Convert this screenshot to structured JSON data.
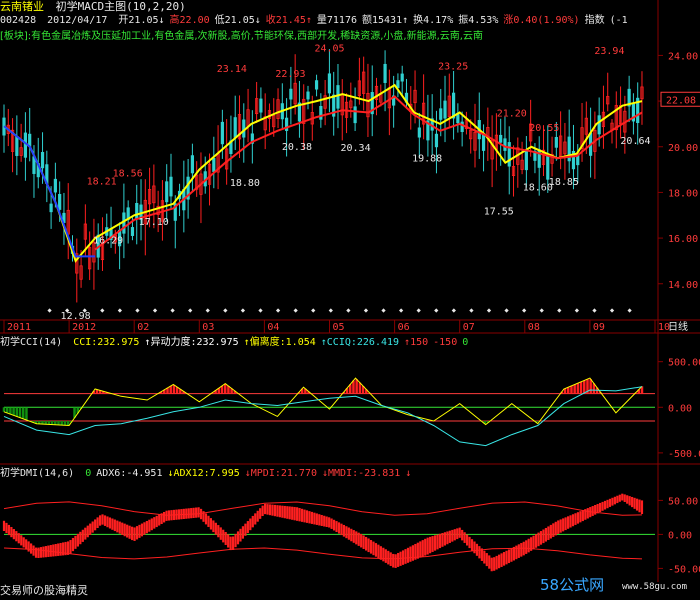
{
  "stock": {
    "name": "云南锗业",
    "indicator": "初学MACD主图(10,2,20)",
    "code": "002428",
    "date": "2012/04/17",
    "quote": [
      {
        "label": "开21.05",
        "dir": "↓",
        "color": "#e8e8e8"
      },
      {
        "label": "高22.00",
        "dir": "",
        "color": "#ff3b3b"
      },
      {
        "label": "低21.05",
        "dir": "↓",
        "color": "#e8e8e8"
      },
      {
        "label": "收21.45",
        "dir": "↑",
        "color": "#ff3b3b"
      },
      {
        "label": "量71176",
        "dir": "",
        "color": "#e8e8e8"
      },
      {
        "label": "额15431",
        "dir": "↑",
        "color": "#e8e8e8"
      },
      {
        "label": "换4.17%",
        "dir": "",
        "color": "#e8e8e8"
      },
      {
        "label": "振4.53%",
        "dir": "",
        "color": "#e8e8e8"
      },
      {
        "label": "涨0.40(1.90%)",
        "dir": "",
        "color": "#ff3b3b"
      },
      {
        "label": "指数",
        "dir": "",
        "color": "#e8e8e8"
      },
      {
        "label": "(-1",
        "dir": "",
        "color": "#e8e8e8"
      }
    ],
    "sector": "[板块]:有色金属冶炼及压延加工业,有色金属,次新股,高价,节能环保,西部开发,稀缺资源,小盘,新能源,云南,云南",
    "current_price": "22.08",
    "period": "日线"
  },
  "cci": {
    "title": "初学CCI(14)",
    "items": [
      {
        "text": "CCI:232.975",
        "color": "#ffff00"
      },
      {
        "text": "↑异动力度:232.975",
        "color": "#ffffff"
      },
      {
        "text": "↑偏离度:1.054",
        "color": "#ffff00"
      },
      {
        "text": "↑CCIQ:226.419",
        "color": "#39e6e6"
      },
      {
        "text": "↑150",
        "color": "#ff3b3b"
      },
      {
        "text": "-150",
        "color": "#ff3b3b"
      },
      {
        "text": "0",
        "color": "#35e635"
      }
    ]
  },
  "dmi": {
    "title": "初学DMI(14,6)",
    "items": [
      {
        "text": "0",
        "color": "#35e635"
      },
      {
        "text": "ADX6:-4.951",
        "color": "#e8e8e8"
      },
      {
        "text": "↓ADX12:7.995",
        "color": "#ffff00"
      },
      {
        "text": "↓MPDI:21.770",
        "color": "#ff3b3b"
      },
      {
        "text": "↓MMDI:-23.831",
        "color": "#ff3b3b"
      },
      {
        "text": "↓",
        "color": "#ff3b3b"
      }
    ]
  },
  "footer": {
    "credit": "交易师の股海精灵",
    "watermark": "58公式网",
    "watermark_url": "www.58gu.com"
  },
  "colors": {
    "up": "#ff2020",
    "down": "#30d0d0",
    "grid": "#880000",
    "ma_fast": "#ffff00",
    "ma_mid": "#2040ff",
    "ma_slow": "#ff2020"
  },
  "chart_data": [
    {
      "type": "candlestick",
      "x_labels": [
        "2011",
        "2012",
        "02",
        "03",
        "04",
        "05",
        "06",
        "07",
        "08",
        "09",
        "10"
      ],
      "ylim": [
        12.5,
        24.5
      ],
      "y_ticks": [
        14.0,
        16.0,
        18.0,
        20.0,
        22.0,
        24.0
      ],
      "annotations": [
        {
          "text": "12.98",
          "value": 12.98,
          "t": 0.11,
          "color": "#e8e8e8"
        },
        {
          "text": "16.29",
          "value": 16.29,
          "t": 0.16,
          "color": "#e8e8e8"
        },
        {
          "text": "17.10",
          "value": 17.1,
          "t": 0.23,
          "color": "#e8e8e8"
        },
        {
          "text": "18.21",
          "value": 18.21,
          "t": 0.15,
          "color": "#ff3b3b"
        },
        {
          "text": "18.56",
          "value": 18.56,
          "t": 0.19,
          "color": "#ff3b3b"
        },
        {
          "text": "23.14",
          "value": 23.14,
          "t": 0.35,
          "color": "#ff3b3b"
        },
        {
          "text": "18.80",
          "value": 18.8,
          "t": 0.37,
          "color": "#e8e8e8"
        },
        {
          "text": "22.93",
          "value": 22.93,
          "t": 0.44,
          "color": "#ff3b3b"
        },
        {
          "text": "20.38",
          "value": 20.38,
          "t": 0.45,
          "color": "#e8e8e8"
        },
        {
          "text": "24.05",
          "value": 24.05,
          "t": 0.5,
          "color": "#ff3b3b"
        },
        {
          "text": "20.34",
          "value": 20.34,
          "t": 0.54,
          "color": "#e8e8e8"
        },
        {
          "text": "19.88",
          "value": 19.88,
          "t": 0.65,
          "color": "#e8e8e8"
        },
        {
          "text": "23.25",
          "value": 23.25,
          "t": 0.69,
          "color": "#ff3b3b"
        },
        {
          "text": "21.20",
          "value": 21.2,
          "t": 0.78,
          "color": "#ff3b3b"
        },
        {
          "text": "17.55",
          "value": 17.55,
          "t": 0.76,
          "color": "#e8e8e8"
        },
        {
          "text": "20.55",
          "value": 20.55,
          "t": 0.83,
          "color": "#ff3b3b"
        },
        {
          "text": "18.60",
          "value": 18.6,
          "t": 0.82,
          "color": "#e8e8e8"
        },
        {
          "text": "18.85",
          "value": 18.85,
          "t": 0.86,
          "color": "#e8e8e8"
        },
        {
          "text": "23.94",
          "value": 23.94,
          "t": 0.93,
          "color": "#ff3b3b"
        },
        {
          "text": "20.64",
          "value": 20.64,
          "t": 0.97,
          "color": "#e8e8e8"
        }
      ],
      "series": [
        {
          "role": "fast",
          "color": "#ffff00",
          "values": [
            [
              0.0,
              20.9
            ],
            [
              0.04,
              20.0
            ],
            [
              0.08,
              17.5
            ],
            [
              0.11,
              15.0
            ],
            [
              0.14,
              16.0
            ],
            [
              0.2,
              17.0
            ],
            [
              0.26,
              17.5
            ],
            [
              0.3,
              19.0
            ],
            [
              0.34,
              20.0
            ],
            [
              0.38,
              21.0
            ],
            [
              0.42,
              21.5
            ],
            [
              0.45,
              21.8
            ],
            [
              0.48,
              22.0
            ],
            [
              0.52,
              22.3
            ],
            [
              0.56,
              22.0
            ],
            [
              0.6,
              22.7
            ],
            [
              0.63,
              21.5
            ],
            [
              0.67,
              21.0
            ],
            [
              0.7,
              21.5
            ],
            [
              0.74,
              20.5
            ],
            [
              0.77,
              19.3
            ],
            [
              0.81,
              20.0
            ],
            [
              0.85,
              19.5
            ],
            [
              0.88,
              19.7
            ],
            [
              0.91,
              21.0
            ],
            [
              0.95,
              21.8
            ],
            [
              0.98,
              22.0
            ]
          ]
        },
        {
          "role": "slow",
          "color": "#ff2020",
          "values": [
            [
              0.14,
              15.5
            ],
            [
              0.2,
              16.8
            ],
            [
              0.26,
              17.3
            ],
            [
              0.3,
              18.3
            ],
            [
              0.34,
              19.3
            ],
            [
              0.38,
              20.2
            ],
            [
              0.42,
              20.7
            ],
            [
              0.45,
              21.0
            ],
            [
              0.48,
              21.3
            ],
            [
              0.52,
              21.6
            ],
            [
              0.56,
              21.5
            ],
            [
              0.6,
              22.2
            ],
            [
              0.63,
              21.4
            ],
            [
              0.67,
              20.7
            ],
            [
              0.7,
              21.0
            ],
            [
              0.74,
              20.5
            ],
            [
              0.77,
              20.0
            ],
            [
              0.81,
              19.8
            ],
            [
              0.85,
              19.5
            ],
            [
              0.88,
              19.6
            ],
            [
              0.91,
              20.3
            ],
            [
              0.95,
              21.0
            ],
            [
              0.98,
              21.5
            ]
          ]
        },
        {
          "role": "mid",
          "color": "#2040ff",
          "values": [
            [
              0.0,
              20.9
            ],
            [
              0.04,
              20.0
            ],
            [
              0.08,
              17.5
            ],
            [
              0.11,
              15.2
            ],
            [
              0.14,
              15.2
            ]
          ]
        }
      ]
    },
    {
      "type": "line",
      "name": "CCI",
      "ylim": [
        -600,
        650
      ],
      "y_ticks": [
        500,
        0,
        -500
      ],
      "lines": [
        150,
        0,
        -150
      ],
      "series": [
        {
          "name": "CCI",
          "color": "#ffff00",
          "values": [
            [
              0.0,
              -50
            ],
            [
              0.05,
              -180
            ],
            [
              0.1,
              -200
            ],
            [
              0.14,
              200
            ],
            [
              0.18,
              120
            ],
            [
              0.22,
              80
            ],
            [
              0.26,
              250
            ],
            [
              0.3,
              60
            ],
            [
              0.34,
              260
            ],
            [
              0.38,
              40
            ],
            [
              0.42,
              -100
            ],
            [
              0.46,
              220
            ],
            [
              0.5,
              -20
            ],
            [
              0.54,
              320
            ],
            [
              0.58,
              20
            ],
            [
              0.62,
              -80
            ],
            [
              0.66,
              -150
            ],
            [
              0.7,
              40
            ],
            [
              0.74,
              -190
            ],
            [
              0.78,
              40
            ],
            [
              0.82,
              -180
            ],
            [
              0.86,
              200
            ],
            [
              0.9,
              320
            ],
            [
              0.94,
              -60
            ],
            [
              0.98,
              230
            ]
          ]
        },
        {
          "name": "CCIQ",
          "color": "#39e6e6",
          "values": [
            [
              0.0,
              -100
            ],
            [
              0.05,
              -250
            ],
            [
              0.1,
              -300
            ],
            [
              0.14,
              -200
            ],
            [
              0.18,
              -180
            ],
            [
              0.22,
              -120
            ],
            [
              0.26,
              -50
            ],
            [
              0.3,
              0
            ],
            [
              0.34,
              80
            ],
            [
              0.38,
              40
            ],
            [
              0.42,
              20
            ],
            [
              0.46,
              60
            ],
            [
              0.5,
              100
            ],
            [
              0.54,
              120
            ],
            [
              0.58,
              20
            ],
            [
              0.62,
              -60
            ],
            [
              0.66,
              -200
            ],
            [
              0.7,
              -380
            ],
            [
              0.74,
              -420
            ],
            [
              0.78,
              -300
            ],
            [
              0.82,
              -200
            ],
            [
              0.86,
              40
            ],
            [
              0.9,
              190
            ],
            [
              0.94,
              180
            ],
            [
              0.98,
              226
            ]
          ]
        }
      ]
    },
    {
      "type": "line",
      "name": "DMI",
      "ylim": [
        -70,
        80
      ],
      "y_ticks": [
        50,
        0,
        -50
      ],
      "series": [
        {
          "name": "MPDI",
          "color": "#ff3b3b",
          "values": [
            [
              0.0,
              20
            ],
            [
              0.05,
              -20
            ],
            [
              0.1,
              -10
            ],
            [
              0.15,
              30
            ],
            [
              0.2,
              10
            ],
            [
              0.25,
              35
            ],
            [
              0.3,
              40
            ],
            [
              0.35,
              -5
            ],
            [
              0.4,
              45
            ],
            [
              0.45,
              40
            ],
            [
              0.5,
              25
            ],
            [
              0.55,
              0
            ],
            [
              0.6,
              -30
            ],
            [
              0.65,
              -5
            ],
            [
              0.7,
              10
            ],
            [
              0.75,
              -35
            ],
            [
              0.8,
              -10
            ],
            [
              0.85,
              20
            ],
            [
              0.9,
              40
            ],
            [
              0.95,
              60
            ],
            [
              0.98,
              50
            ]
          ]
        },
        {
          "name": "MMDI",
          "color": "#39e6e6",
          "values": [
            [
              0.0,
              5
            ],
            [
              0.05,
              -35
            ],
            [
              0.1,
              -30
            ],
            [
              0.15,
              15
            ],
            [
              0.2,
              -10
            ],
            [
              0.25,
              20
            ],
            [
              0.3,
              25
            ],
            [
              0.35,
              -25
            ],
            [
              0.4,
              30
            ],
            [
              0.45,
              20
            ],
            [
              0.5,
              10
            ],
            [
              0.55,
              -20
            ],
            [
              0.6,
              -50
            ],
            [
              0.65,
              -30
            ],
            [
              0.7,
              -5
            ],
            [
              0.75,
              -55
            ],
            [
              0.8,
              -30
            ],
            [
              0.85,
              0
            ],
            [
              0.9,
              25
            ],
            [
              0.95,
              50
            ],
            [
              0.98,
              30
            ]
          ]
        }
      ]
    }
  ]
}
